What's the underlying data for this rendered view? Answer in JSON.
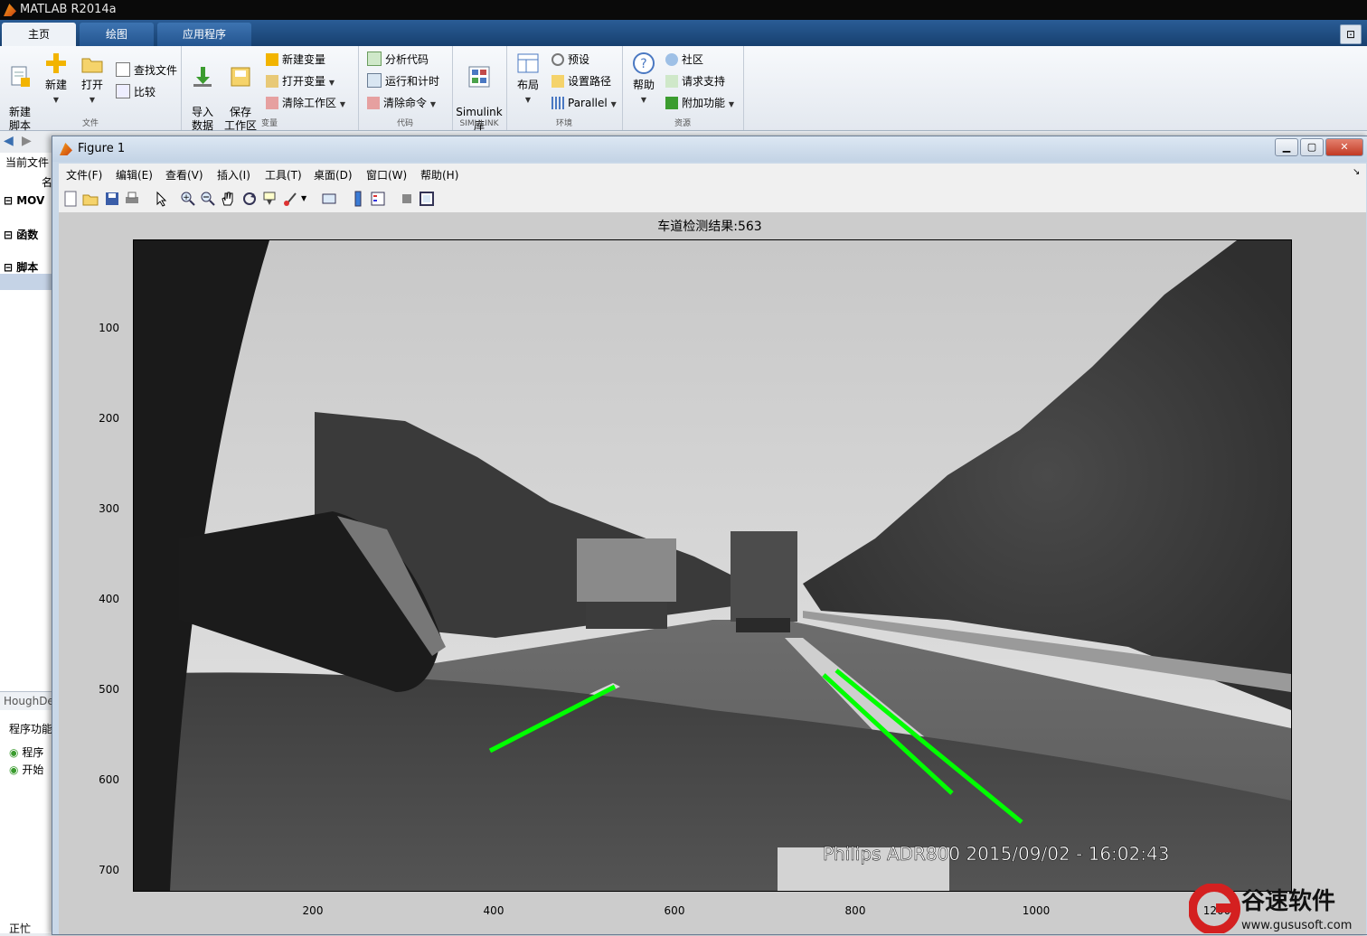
{
  "app": {
    "title": "MATLAB R2014a"
  },
  "tabs": [
    {
      "label": "主页",
      "selected": true
    },
    {
      "label": "绘图",
      "selected": false
    },
    {
      "label": "应用程序",
      "selected": false
    }
  ],
  "ribbon": {
    "file": {
      "title": "文件",
      "new_script": "新建\n脚本",
      "new": "新建",
      "open": "打开",
      "find_files": "查找文件",
      "compare": "比较"
    },
    "variable": {
      "title": "变量",
      "import_data": "导入\n数据",
      "save_workspace": "保存\n工作区",
      "new_variable": "新建变量",
      "open_variable": "打开变量",
      "clear_workspace": "清除工作区"
    },
    "code": {
      "title": "代码",
      "analyze_code": "分析代码",
      "run_and_time": "运行和计时",
      "clear_commands": "清除命令"
    },
    "simulink": {
      "title": "SIMULINK",
      "library": "Simulink\n库"
    },
    "environment": {
      "title": "环境",
      "layout": "布局",
      "preferences": "预设",
      "set_path": "设置路径",
      "parallel": "Parallel"
    },
    "resources": {
      "title": "资源",
      "help": "帮助",
      "community": "社区",
      "request_support": "请求支持",
      "add_ons": "附加功能"
    }
  },
  "left_panel": {
    "current_folder_label": "当前文件",
    "name_header": "名",
    "mov_label": "MOV",
    "functions_label": "函数",
    "scripts_label": "脚本",
    "detail_label": "HoughDet",
    "program_label": "程序功能",
    "item1": "程序",
    "item2": "开始",
    "status": "正忙"
  },
  "figure": {
    "window_title": "Figure 1",
    "menu": [
      "文件(F)",
      "编辑(E)",
      "查看(V)",
      "插入(I)",
      "工具(T)",
      "桌面(D)",
      "窗口(W)",
      "帮助(H)"
    ],
    "plot_title": "车道检测结果:563",
    "y_ticks": [
      "100",
      "200",
      "300",
      "400",
      "500",
      "600",
      "700"
    ],
    "x_ticks": [
      "200",
      "400",
      "600",
      "800",
      "1000",
      "1200"
    ],
    "image_overlay_text": "Philips ADR800 2015/09/02 -  16:02:43",
    "line_color": "#00ff00"
  },
  "watermark": {
    "brand": "谷速软件",
    "url": "www.gususoft.com"
  }
}
